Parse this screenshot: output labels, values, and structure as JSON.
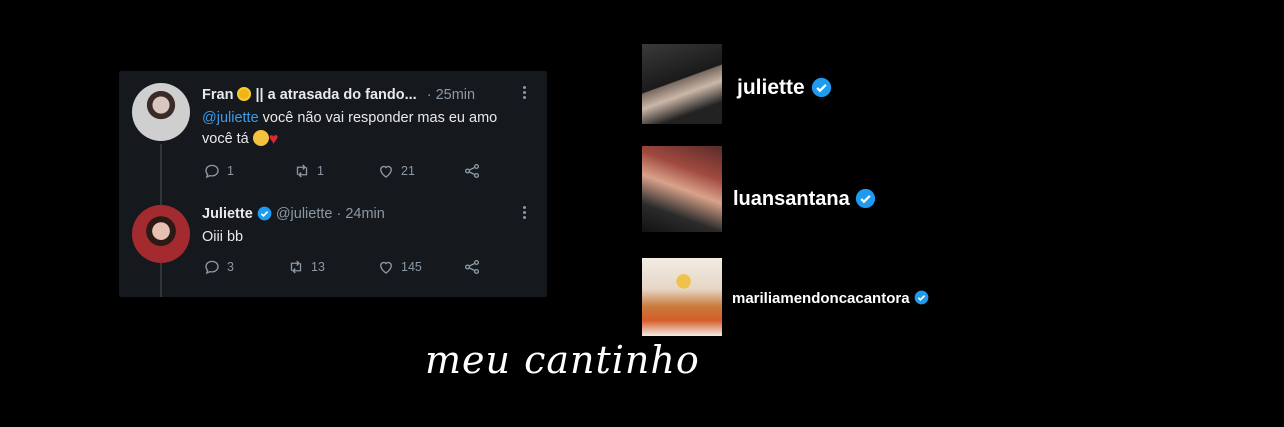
{
  "tweets": [
    {
      "display_name": "Fran",
      "name_suffix": "|| a atrasada do fando...",
      "time": "· 25min",
      "mention": "@juliette",
      "text_after_mention": " você não vai responder mas eu amo",
      "text_line2": "você tá",
      "counts": {
        "reply": "1",
        "retweet": "1",
        "like": "21"
      }
    },
    {
      "display_name": "Juliette",
      "handle_time": "@juliette · 24min",
      "text": "Oiii bb",
      "counts": {
        "reply": "3",
        "retweet": "13",
        "like": "145"
      }
    }
  ],
  "profiles": [
    {
      "username": "juliette"
    },
    {
      "username": "luansantana"
    },
    {
      "username": "mariliamendoncacantora"
    }
  ],
  "caption": "meu cantinho",
  "colors": {
    "background": "#000000",
    "card": "#15181c",
    "link": "#3d9be9",
    "verified": "#1d9bf0",
    "heart": "#e0263a"
  },
  "icons": [
    "reply-icon",
    "retweet-icon",
    "like-icon",
    "share-icon",
    "more-icon",
    "verified-icon"
  ]
}
